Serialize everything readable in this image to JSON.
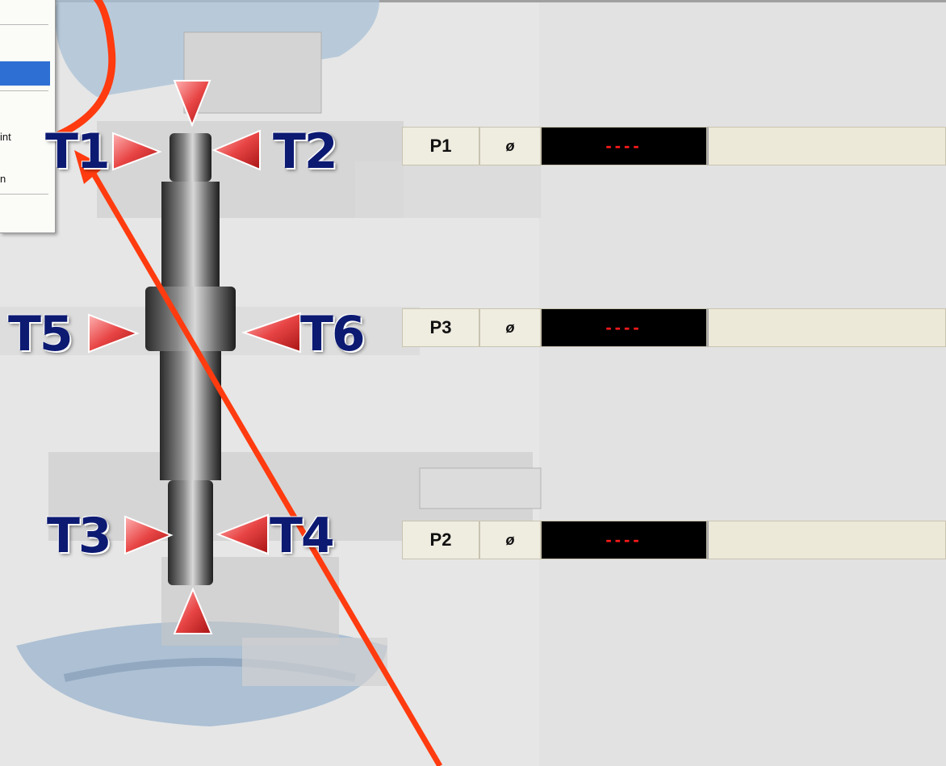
{
  "menu": {
    "items": [
      {
        "label": "int"
      },
      {
        "label": "n"
      }
    ]
  },
  "points": [
    {
      "label": "P1",
      "symbol": "ø",
      "value": "----"
    },
    {
      "label": "P3",
      "symbol": "ø",
      "value": "----"
    },
    {
      "label": "P2",
      "symbol": "ø",
      "value": "----"
    }
  ],
  "tags": {
    "t1": "T1",
    "t2": "T2",
    "t3": "T3",
    "t4": "T4",
    "t5": "T5",
    "t6": "T6"
  },
  "colors": {
    "annotation": "#ff3b0f",
    "tag_text": "#0c1a72",
    "readout_text": "#ff1a1a",
    "readout_bg": "#000000",
    "menu_highlight": "#2e6fd3"
  }
}
